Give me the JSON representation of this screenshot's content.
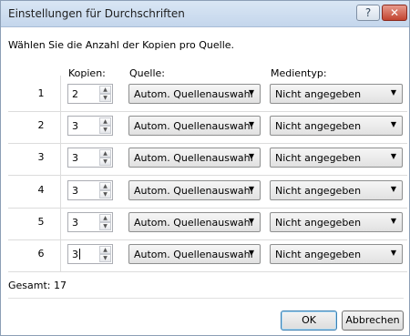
{
  "window": {
    "title": "Einstellungen für Durchschriften",
    "help_label": "?",
    "close_label": "✕"
  },
  "intro": "Wählen Sie die Anzahl der Kopien pro Quelle.",
  "columns": {
    "copies": "Kopien:",
    "source": "Quelle:",
    "media": "Medientyp:"
  },
  "rows": [
    {
      "num": "1",
      "copies": "2",
      "source": "Autom. Quellenauswahl",
      "media": "Nicht angegeben"
    },
    {
      "num": "2",
      "copies": "3",
      "source": "Autom. Quellenauswahl",
      "media": "Nicht angegeben"
    },
    {
      "num": "3",
      "copies": "3",
      "source": "Autom. Quellenauswahl",
      "media": "Nicht angegeben"
    },
    {
      "num": "4",
      "copies": "3",
      "source": "Autom. Quellenauswahl",
      "media": "Nicht angegeben"
    },
    {
      "num": "5",
      "copies": "3",
      "source": "Autom. Quellenauswahl",
      "media": "Nicht angegeben"
    },
    {
      "num": "6",
      "copies": "3",
      "source": "Autom. Quellenauswahl",
      "media": "Nicht angegeben"
    }
  ],
  "total": "Gesamt: 17",
  "buttons": {
    "ok": "OK",
    "cancel": "Abbrechen"
  },
  "icons": {
    "help": "help-icon",
    "close": "close-icon",
    "dropdown": "chevron-down-icon",
    "spin_up": "spin-up-icon",
    "spin_down": "spin-down-icon"
  },
  "colors": {
    "titlebar": "#c4d6ec",
    "close": "#c24430",
    "default_button_border": "#3c7fb1"
  }
}
